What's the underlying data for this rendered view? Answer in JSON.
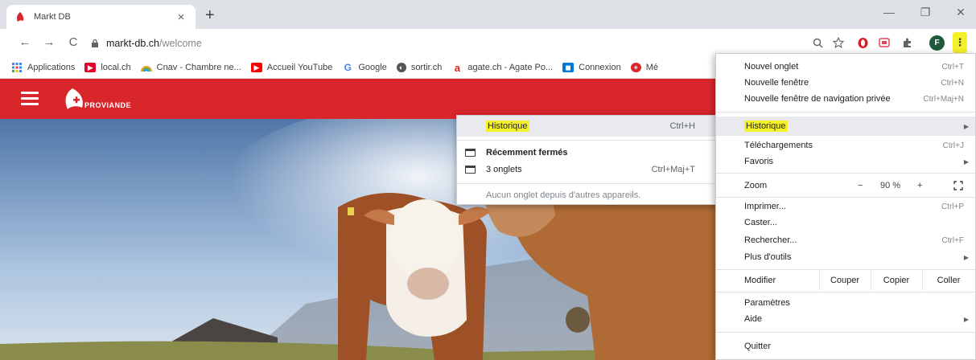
{
  "tab": {
    "title": "Markt DB",
    "close": "×"
  },
  "window": {
    "newtab": "+",
    "minimize": "—",
    "maximize": "❐",
    "close": "✕"
  },
  "toolbar": {
    "back": "←",
    "forward": "→",
    "reload": "C",
    "url_host": "markt-db.ch",
    "url_path": "/welcome",
    "avatar_letter": "F",
    "menu_glyph": "⋮"
  },
  "bookmarks": [
    {
      "label": "Applications",
      "icon": "apps-icon",
      "color": "#4285f4"
    },
    {
      "label": "local.ch",
      "icon": "localch-icon",
      "color": "#e4002b"
    },
    {
      "label": "Cnav - Chambre ne...",
      "icon": "cnav-icon",
      "color": "#f0a020"
    },
    {
      "label": "Accueil YouTube",
      "icon": "youtube-icon",
      "color": "#ff0000"
    },
    {
      "label": "Google",
      "icon": "google-icon",
      "color": "#4285f4"
    },
    {
      "label": "sortir.ch",
      "icon": "sortir-icon",
      "color": "#555555"
    },
    {
      "label": "agate.ch - Agate Po...",
      "icon": "agate-icon",
      "color": "#d52b1e"
    },
    {
      "label": "Connexion",
      "icon": "connexion-icon",
      "color": "#0078d4"
    },
    {
      "label": "Mé",
      "icon": "swiss-icon",
      "color": "#d8262b"
    }
  ],
  "page": {
    "logo_text": "PROVIANDE",
    "brand_color": "#d8262b"
  },
  "submenu": {
    "history_label": "Historique",
    "history_shortcut": "Ctrl+H",
    "recent_header": "Récemment fermés",
    "tabs_label": "3 onglets",
    "tabs_shortcut": "Ctrl+Maj+T",
    "no_tabs": "Aucun onglet depuis d'autres appareils."
  },
  "menu": {
    "new_tab": "Nouvel onglet",
    "new_tab_sc": "Ctrl+T",
    "new_window": "Nouvelle fenêtre",
    "new_window_sc": "Ctrl+N",
    "incognito": "Nouvelle fenêtre de navigation privée",
    "incognito_sc": "Ctrl+Maj+N",
    "history": "Historique",
    "downloads": "Téléchargements",
    "downloads_sc": "Ctrl+J",
    "bookmarks": "Favoris",
    "zoom": "Zoom",
    "zoom_minus": "−",
    "zoom_value": "90 %",
    "zoom_plus": "+",
    "print": "Imprimer...",
    "print_sc": "Ctrl+P",
    "cast": "Caster...",
    "find": "Rechercher...",
    "find_sc": "Ctrl+F",
    "more_tools": "Plus d'outils",
    "edit": "Modifier",
    "cut": "Couper",
    "copy": "Copier",
    "paste": "Coller",
    "settings": "Paramètres",
    "help": "Aide",
    "quit": "Quitter"
  },
  "colors": {
    "highlight": "#f4f02a",
    "tabstrip": "#dee1e6"
  }
}
